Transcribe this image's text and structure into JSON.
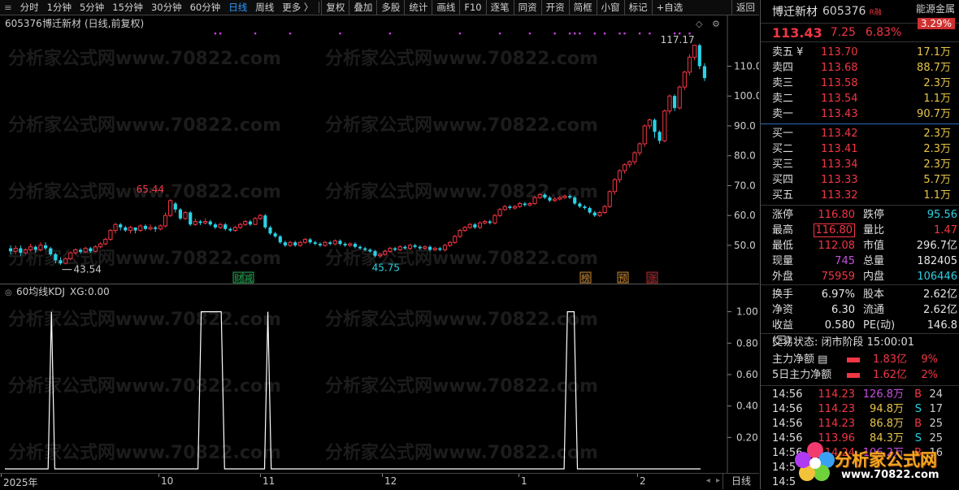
{
  "toolbar": {
    "items": [
      "分时",
      "1分钟",
      "5分钟",
      "15分钟",
      "30分钟",
      "60分钟",
      "日线",
      "周线",
      "更多 〉"
    ],
    "active_index": 6,
    "tools": [
      "复权",
      "叠加",
      "多股",
      "统计",
      "画线",
      "F10",
      "逐笔",
      "同资",
      "开资",
      "简框",
      "小窗",
      "标记",
      "+自选"
    ],
    "back": "返回"
  },
  "chart_header": {
    "code": "605376",
    "name": "博迁新材",
    "mode": "(日线,前复权)"
  },
  "chart_annotations": {
    "high": "117.17",
    "peak": "65.44",
    "low1": "43.54",
    "low2": "45.75"
  },
  "markers": [
    {
      "text": "财",
      "color": "#1aa84a"
    },
    {
      "text": "减",
      "color": "#1aa84a"
    },
    {
      "text": "榜",
      "color": "#c8842a"
    },
    {
      "text": "预",
      "color": "#c8842a"
    },
    {
      "text": "涨",
      "color": "#c0262c"
    }
  ],
  "indicator": {
    "title": "60均线KDJ",
    "xg_label": "XG:",
    "xg_value": "0.00"
  },
  "x_axis": [
    "2025年",
    "10",
    "11",
    "12",
    "1",
    "2"
  ],
  "period_button": "日线",
  "chart_data": [
    {
      "type": "candlestick",
      "y_ticks": [
        50.0,
        60.0,
        70.0,
        80.0,
        90.0,
        100.0,
        110.0
      ],
      "y_tick_labels": [
        "50.0",
        "60.0",
        "70.0",
        "80.0",
        "90.0",
        "100.0",
        "110.0"
      ],
      "ylim": [
        41,
        121
      ],
      "candles": [
        [
          49,
          48,
          50,
          47
        ],
        [
          48,
          49,
          50,
          47
        ],
        [
          49,
          47.5,
          50,
          46.5
        ],
        [
          47.5,
          48.5,
          49,
          46.8
        ],
        [
          48.5,
          49.5,
          50.5,
          48
        ],
        [
          49.5,
          48.5,
          50,
          47.5
        ],
        [
          48.5,
          50,
          51,
          48
        ],
        [
          50,
          49,
          51,
          48.5
        ],
        [
          49,
          47,
          49.5,
          46.5
        ],
        [
          47,
          45,
          47.5,
          44
        ],
        [
          45,
          44,
          46,
          43.54
        ],
        [
          44,
          45.5,
          46,
          43.8
        ],
        [
          45.5,
          47.5,
          48,
          45
        ],
        [
          47.5,
          48.5,
          49,
          47
        ],
        [
          48.5,
          47.8,
          49,
          47.2
        ],
        [
          47.8,
          49,
          49.5,
          47.5
        ],
        [
          49,
          48,
          49.5,
          47.5
        ],
        [
          48,
          49.5,
          50,
          47.8
        ],
        [
          49.5,
          50.5,
          51,
          49
        ],
        [
          50.5,
          52,
          52.5,
          50
        ],
        [
          52,
          55,
          55.5,
          51.5
        ],
        [
          55,
          57,
          57.5,
          54
        ],
        [
          57,
          56,
          57.5,
          55
        ],
        [
          56,
          55,
          56.5,
          54.5
        ],
        [
          55,
          56,
          56.5,
          54
        ],
        [
          56,
          55,
          56,
          54
        ],
        [
          55,
          56.5,
          57,
          54.5
        ],
        [
          56.5,
          55.5,
          57,
          55
        ],
        [
          55.5,
          56,
          57,
          55
        ],
        [
          56,
          55.5,
          56.5,
          54.5
        ],
        [
          55.5,
          56.5,
          57,
          55
        ],
        [
          56.5,
          60,
          61,
          56
        ],
        [
          60,
          65,
          65.44,
          59.5
        ],
        [
          64,
          62,
          64.5,
          61
        ],
        [
          62,
          59,
          62.5,
          58.5
        ],
        [
          59,
          61,
          61.5,
          58.5
        ],
        [
          61,
          57,
          61.5,
          56.5
        ],
        [
          57,
          58,
          59,
          56.5
        ],
        [
          58,
          57.5,
          58.5,
          56.8
        ],
        [
          57.5,
          58,
          59,
          57
        ],
        [
          58,
          57,
          58.5,
          56.5
        ],
        [
          57,
          56,
          57.5,
          55.5
        ],
        [
          56,
          57,
          57.5,
          55.5
        ],
        [
          57,
          55.5,
          57.5,
          55
        ],
        [
          55.5,
          55,
          56,
          54.5
        ],
        [
          55,
          56,
          56.5,
          54.5
        ],
        [
          56,
          57,
          57.5,
          55.5
        ],
        [
          57,
          58,
          58.5,
          56.5
        ],
        [
          58,
          57,
          58.5,
          56.5
        ],
        [
          57,
          59,
          59.5,
          56.8
        ],
        [
          59,
          60,
          60.5,
          58.5
        ],
        [
          60,
          56,
          60.5,
          55.5
        ],
        [
          56,
          54,
          56.5,
          53.5
        ],
        [
          54,
          53,
          54.5,
          52.5
        ],
        [
          53,
          51,
          53.5,
          50.5
        ],
        [
          51,
          50,
          51.5,
          49.5
        ],
        [
          50,
          51,
          51.5,
          49.5
        ],
        [
          51,
          50,
          51.5,
          49.5
        ],
        [
          50,
          51,
          51.5,
          49.5
        ],
        [
          51,
          52,
          52.5,
          50.5
        ],
        [
          52,
          51,
          52.5,
          50.5
        ],
        [
          51,
          50.5,
          51.5,
          50
        ],
        [
          50.5,
          50,
          51,
          49.5
        ],
        [
          50,
          51,
          51.5,
          49.5
        ],
        [
          51,
          50.5,
          51.5,
          50
        ],
        [
          50.5,
          51.5,
          52,
          50
        ],
        [
          51.5,
          50.5,
          52,
          50
        ],
        [
          50.5,
          50,
          51,
          49.5
        ],
        [
          50,
          50.5,
          51,
          49.5
        ],
        [
          50.5,
          49.5,
          51,
          49
        ],
        [
          49.5,
          49,
          50,
          48.5
        ],
        [
          49,
          48.5,
          49.5,
          48
        ],
        [
          48.5,
          48,
          49,
          47.5
        ],
        [
          48,
          46.5,
          48.5,
          46
        ],
        [
          46.5,
          47,
          47.5,
          45.75
        ],
        [
          47,
          48,
          48.5,
          46.5
        ],
        [
          48,
          49,
          49.5,
          47.5
        ],
        [
          49,
          48.5,
          49.5,
          48
        ],
        [
          48.5,
          49.5,
          50,
          48
        ],
        [
          49.5,
          49,
          50,
          48.5
        ],
        [
          49,
          50,
          50.5,
          48.5
        ],
        [
          50,
          49.5,
          50.5,
          49
        ],
        [
          49.5,
          49,
          50,
          48.5
        ],
        [
          49,
          49.5,
          50,
          48.5
        ],
        [
          49.5,
          48.5,
          50,
          48
        ],
        [
          48.5,
          49,
          49.5,
          48
        ],
        [
          49,
          48.5,
          49.5,
          48
        ],
        [
          48.5,
          50,
          50.5,
          48
        ],
        [
          50,
          51,
          51.5,
          49.5
        ],
        [
          51,
          53,
          53.5,
          50.5
        ],
        [
          53,
          55,
          55.5,
          52.5
        ],
        [
          55,
          56,
          56.5,
          54.5
        ],
        [
          56,
          57,
          57.5,
          55.5
        ],
        [
          57,
          56,
          57.5,
          55.5
        ],
        [
          56,
          57.5,
          58,
          55.5
        ],
        [
          57.5,
          58,
          58.5,
          57
        ],
        [
          58,
          57.5,
          58.5,
          57
        ],
        [
          57.5,
          60,
          60.5,
          57
        ],
        [
          60,
          62,
          62.5,
          59.5
        ],
        [
          62,
          63,
          63.5,
          61.5
        ],
        [
          63,
          62.5,
          63.5,
          62
        ],
        [
          62.5,
          63,
          63.5,
          62
        ],
        [
          63,
          64,
          64.5,
          62.5
        ],
        [
          64,
          63.5,
          64.5,
          63
        ],
        [
          63.5,
          64,
          64.5,
          63
        ],
        [
          64,
          66,
          66.5,
          63.5
        ],
        [
          66,
          67,
          67.5,
          65.5
        ],
        [
          67,
          66,
          67.5,
          65.5
        ],
        [
          66,
          65,
          66.5,
          64.5
        ],
        [
          65,
          65.5,
          66,
          64.5
        ],
        [
          65.5,
          66,
          66.5,
          65
        ],
        [
          66,
          66.5,
          67,
          65.5
        ],
        [
          66.5,
          66,
          67,
          65.5
        ],
        [
          66,
          64,
          66.5,
          63.5
        ],
        [
          64,
          63,
          64.5,
          62.5
        ],
        [
          63,
          62.5,
          63.5,
          62
        ],
        [
          62.5,
          61,
          63,
          60.5
        ],
        [
          61,
          60,
          61.5,
          59.5
        ],
        [
          60,
          61,
          61.5,
          59.5
        ],
        [
          61,
          63,
          63.5,
          60.5
        ],
        [
          63,
          68,
          68.5,
          62.5
        ],
        [
          68,
          72,
          72.5,
          67
        ],
        [
          72,
          75,
          75.5,
          71
        ],
        [
          75,
          77,
          77.5,
          74
        ],
        [
          77,
          78,
          78.5,
          76
        ],
        [
          78,
          81,
          81.5,
          77
        ],
        [
          81,
          84,
          84.5,
          80
        ],
        [
          84,
          90,
          90.5,
          83
        ],
        [
          90,
          92,
          92.5,
          89
        ],
        [
          92,
          88,
          92.5,
          86
        ],
        [
          88,
          85,
          88.5,
          84
        ],
        [
          85,
          95,
          95.5,
          84.5
        ],
        [
          95,
          100,
          100.5,
          94
        ],
        [
          100,
          96,
          100.5,
          95
        ],
        [
          96,
          103,
          103.5,
          95.5
        ],
        [
          103,
          108,
          108.5,
          102
        ],
        [
          108,
          113,
          114,
          107
        ],
        [
          113,
          117,
          117.17,
          112
        ],
        [
          117,
          110,
          117.5,
          109
        ],
        [
          110,
          106,
          111,
          105
        ]
      ],
      "annotations": [
        {
          "label": "117.17",
          "index": 137
        },
        {
          "label": "65.44",
          "index": 32
        },
        {
          "label": "43.54",
          "index": 10
        },
        {
          "label": "45.75",
          "index": 74
        }
      ]
    },
    {
      "type": "line",
      "title": "60均线KDJ",
      "y_ticks": [
        0.2,
        0.4,
        0.6,
        0.8,
        1.0
      ],
      "y_tick_labels": [
        "0.20",
        "0.40",
        "0.60",
        "0.80",
        "1.00"
      ],
      "ylim": [
        0,
        1.06
      ],
      "values": [
        0,
        0,
        0,
        0,
        0,
        0,
        0,
        0,
        0,
        0,
        0,
        0,
        0,
        0,
        1,
        0,
        0,
        0,
        0,
        0,
        0,
        0,
        0,
        0,
        0,
        0,
        0,
        0,
        0,
        0,
        0,
        0,
        0,
        0,
        0,
        0,
        0,
        0,
        0,
        0,
        0,
        0,
        0,
        0,
        0,
        0,
        0,
        0,
        0,
        0,
        0,
        0,
        0,
        0,
        0,
        0,
        0,
        0,
        0,
        1,
        1,
        1,
        1,
        1,
        1,
        1,
        0,
        0,
        0,
        0,
        0,
        0,
        0,
        0,
        0,
        0,
        0,
        0,
        0,
        1,
        0,
        0,
        0,
        0,
        0,
        0,
        0,
        0,
        0,
        0,
        0,
        0,
        0,
        0,
        0,
        0,
        0,
        0,
        0,
        0,
        0,
        0,
        0,
        0,
        0,
        0,
        0,
        0,
        0,
        0,
        0,
        0,
        0,
        0,
        0,
        0,
        0,
        0,
        0,
        0,
        0,
        0,
        0,
        0,
        0,
        0,
        0,
        0,
        0,
        0,
        0,
        0,
        0,
        0,
        0,
        0,
        0,
        0,
        0,
        0,
        0,
        0,
        0,
        0,
        0,
        0,
        0,
        0,
        0,
        0,
        0,
        0,
        0,
        0,
        0,
        0,
        0,
        0,
        0,
        0,
        0,
        0,
        0,
        0,
        0,
        0,
        0,
        0,
        0,
        1,
        1,
        1,
        0,
        0,
        0,
        0,
        0,
        0,
        0,
        0,
        0,
        0,
        0,
        0,
        0,
        0,
        0,
        0,
        0,
        0,
        0,
        0,
        0,
        0,
        0,
        0,
        0,
        0,
        0,
        0,
        0,
        0,
        0,
        0,
        0,
        0,
        0,
        0,
        0,
        0
      ]
    }
  ],
  "panel": {
    "name": "博迁新材",
    "code": "605376",
    "badge": "R融",
    "sector_name": "能源金属",
    "sector_pct": "3.29%",
    "price": "113.43",
    "change": "7.25",
    "pct": "6.83%",
    "asks": [
      {
        "label": "卖五 ¥",
        "price": "113.70",
        "vol": "17.1万"
      },
      {
        "label": "卖四",
        "price": "113.68",
        "vol": "88.7万"
      },
      {
        "label": "卖三",
        "price": "113.58",
        "vol": "2.3万"
      },
      {
        "label": "卖二",
        "price": "113.54",
        "vol": "1.1万"
      },
      {
        "label": "卖一",
        "price": "113.43",
        "vol": "90.7万"
      }
    ],
    "bids": [
      {
        "label": "买一",
        "price": "113.42",
        "vol": "2.3万"
      },
      {
        "label": "买二",
        "price": "113.41",
        "vol": "2.3万"
      },
      {
        "label": "买三",
        "price": "113.34",
        "vol": "2.3万"
      },
      {
        "label": "买四",
        "price": "113.33",
        "vol": "5.7万"
      },
      {
        "label": "买五",
        "price": "113.32",
        "vol": "1.1万"
      }
    ],
    "stats1": [
      {
        "l1": "涨停",
        "v1": "116.80",
        "c1": "red",
        "l2": "跌停",
        "v2": "95.56",
        "c2": "cyan"
      },
      {
        "l1": "最高",
        "v1": "116.80",
        "c1": "red boxed",
        "l2": "量比",
        "v2": "1.47",
        "c2": "red"
      },
      {
        "l1": "最低",
        "v1": "112.08",
        "c1": "red",
        "l2": "市值",
        "v2": "296.7亿",
        "c2": "white"
      },
      {
        "l1": "现量",
        "v1": "745",
        "c1": "purple",
        "l2": "总量",
        "v2": "182405",
        "c2": "white"
      },
      {
        "l1": "外盘",
        "v1": "75959",
        "c1": "red",
        "l2": "内盘",
        "v2": "106446",
        "c2": "cyan"
      }
    ],
    "stats2": [
      {
        "l1": "换手",
        "v1": "6.97%",
        "c1": "white",
        "l2": "股本",
        "v2": "2.62亿",
        "c2": "white"
      },
      {
        "l1": "净资",
        "v1": "6.30",
        "c1": "white",
        "l2": "流通",
        "v2": "2.62亿",
        "c2": "white"
      },
      {
        "l1": "收益(三)",
        "v1": "0.580",
        "c1": "white",
        "l2": "PE(动)",
        "v2": "146.8",
        "c2": "white"
      }
    ],
    "trade_state": "交易状态: 闭市阶段 15:00:01",
    "flows": [
      {
        "label": "主力净额 ▤",
        "value": "1.83亿",
        "pct": "9%"
      },
      {
        "label": "5日主力净额",
        "value": "1.62亿",
        "pct": "2%"
      }
    ],
    "ticks": [
      {
        "t": "14:56",
        "p": "114.23",
        "v": "126.8万",
        "vc": "purple",
        "d": "B",
        "n": "24"
      },
      {
        "t": "14:56",
        "p": "114.23",
        "v": "94.8万",
        "vc": "yellow",
        "d": "S",
        "n": "17"
      },
      {
        "t": "14:56",
        "p": "114.23",
        "v": "86.8万",
        "vc": "yellow",
        "d": "B",
        "n": "25"
      },
      {
        "t": "14:56",
        "p": "113.96",
        "v": "84.3万",
        "vc": "yellow",
        "d": "S",
        "n": "25"
      },
      {
        "t": "14:56",
        "p": "114.24",
        "v": "106.2万",
        "vc": "purple",
        "d": "B",
        "n": "16"
      },
      {
        "t": "14:5",
        "p": "",
        "v": "",
        "vc": "yellow",
        "d": "",
        "n": ""
      },
      {
        "t": "14:5",
        "p": "",
        "v": "",
        "vc": "yellow",
        "d": "",
        "n": ""
      }
    ]
  },
  "logo": {
    "text": "分析家公式网",
    "url": "www.70822.com"
  },
  "watermark": "分析家公式网www.70822.com"
}
